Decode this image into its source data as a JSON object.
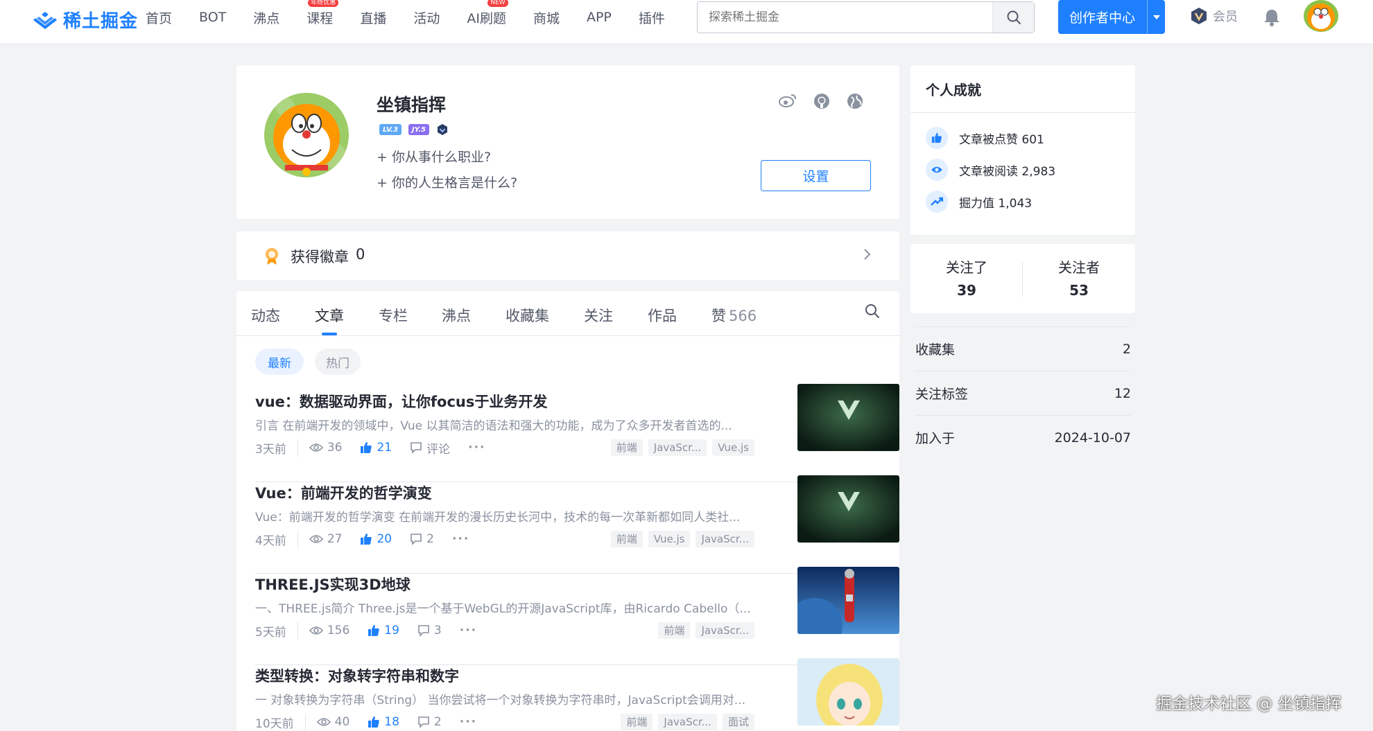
{
  "header": {
    "logo_text": "稀土掘金",
    "nav": [
      {
        "label": "首页"
      },
      {
        "label": "BOT"
      },
      {
        "label": "沸点"
      },
      {
        "label": "课程",
        "badge": "年终优惠"
      },
      {
        "label": "直播"
      },
      {
        "label": "活动"
      },
      {
        "label": "AI刷题",
        "badge": "NEW"
      },
      {
        "label": "商城"
      },
      {
        "label": "APP"
      },
      {
        "label": "插件"
      }
    ],
    "search_placeholder": "探索稀土掘金",
    "creator_label": "创作者中心",
    "vip_label": "会员",
    "accent": "#1e80ff"
  },
  "profile": {
    "name": "坐镇指挥",
    "level_badge": "LV.3",
    "jy_badge": "JY.5",
    "question_job": "+ 你从事什么职业?",
    "question_motto": "+ 你的人生格言是什么?",
    "settings_label": "设置",
    "socials": [
      "weibo-icon",
      "github-icon",
      "globe-icon"
    ]
  },
  "badges": {
    "label": "获得徽章",
    "count": "0"
  },
  "tabs": [
    {
      "label": "动态"
    },
    {
      "label": "文章",
      "active": true
    },
    {
      "label": "专栏"
    },
    {
      "label": "沸点"
    },
    {
      "label": "收藏集"
    },
    {
      "label": "关注"
    },
    {
      "label": "作品"
    },
    {
      "label": "赞",
      "count": "566"
    }
  ],
  "filters": {
    "latest": "最新",
    "hot": "热门"
  },
  "articles": [
    {
      "title": "vue：数据驱动界面，让你focus于业务开发",
      "excerpt": "引言 在前端开发的领域中，Vue 以其简洁的语法和强大的功能，成为了众多开发者首选的...",
      "time": "3天前",
      "views": "36",
      "likes": "21",
      "comments": "评论",
      "tags": [
        "前端",
        "JavaScr...",
        "Vue.js"
      ],
      "thumb": "vue"
    },
    {
      "title": "Vue：前端开发的哲学演变",
      "excerpt": "Vue：前端开发的哲学演变 在前端开发的漫长历史长河中，技术的每一次革新都如同人类社...",
      "time": "4天前",
      "views": "27",
      "likes": "20",
      "comments": "2",
      "tags": [
        "前端",
        "Vue.js",
        "JavaScr..."
      ],
      "thumb": "vue"
    },
    {
      "title": "THREE.JS实现3D地球",
      "excerpt": "一、THREE.js简介 Three.js是一个基于WebGL的开源JavaScript库，由Ricardo Cabello（...",
      "time": "5天前",
      "views": "156",
      "likes": "19",
      "comments": "3",
      "tags": [
        "前端",
        "JavaScr..."
      ],
      "thumb": "hero"
    },
    {
      "title": "类型转换：对象转字符串和数字",
      "excerpt": "一 对象转换为字符串（String） 当你尝试将一个对象转换为字符串时，JavaScript会调用对...",
      "time": "10天前",
      "views": "40",
      "likes": "18",
      "comments": "2",
      "tags": [
        "前端",
        "JavaScr...",
        "面试"
      ],
      "thumb": "anime"
    }
  ],
  "achievements": {
    "title": "个人成就",
    "items": [
      {
        "label": "文章被点赞",
        "value": "601"
      },
      {
        "label": "文章被阅读",
        "value": "2,983"
      },
      {
        "label": "掘力值",
        "value": "1,043"
      }
    ]
  },
  "follow": {
    "following_label": "关注了",
    "following": "39",
    "followers_label": "关注者",
    "followers": "53"
  },
  "stats": [
    {
      "label": "收藏集",
      "value": "2"
    },
    {
      "label": "关注标签",
      "value": "12"
    },
    {
      "label": "加入于",
      "value": "2024-10-07"
    }
  ],
  "watermark": "掘金技术社区 @ 坐镇指挥"
}
